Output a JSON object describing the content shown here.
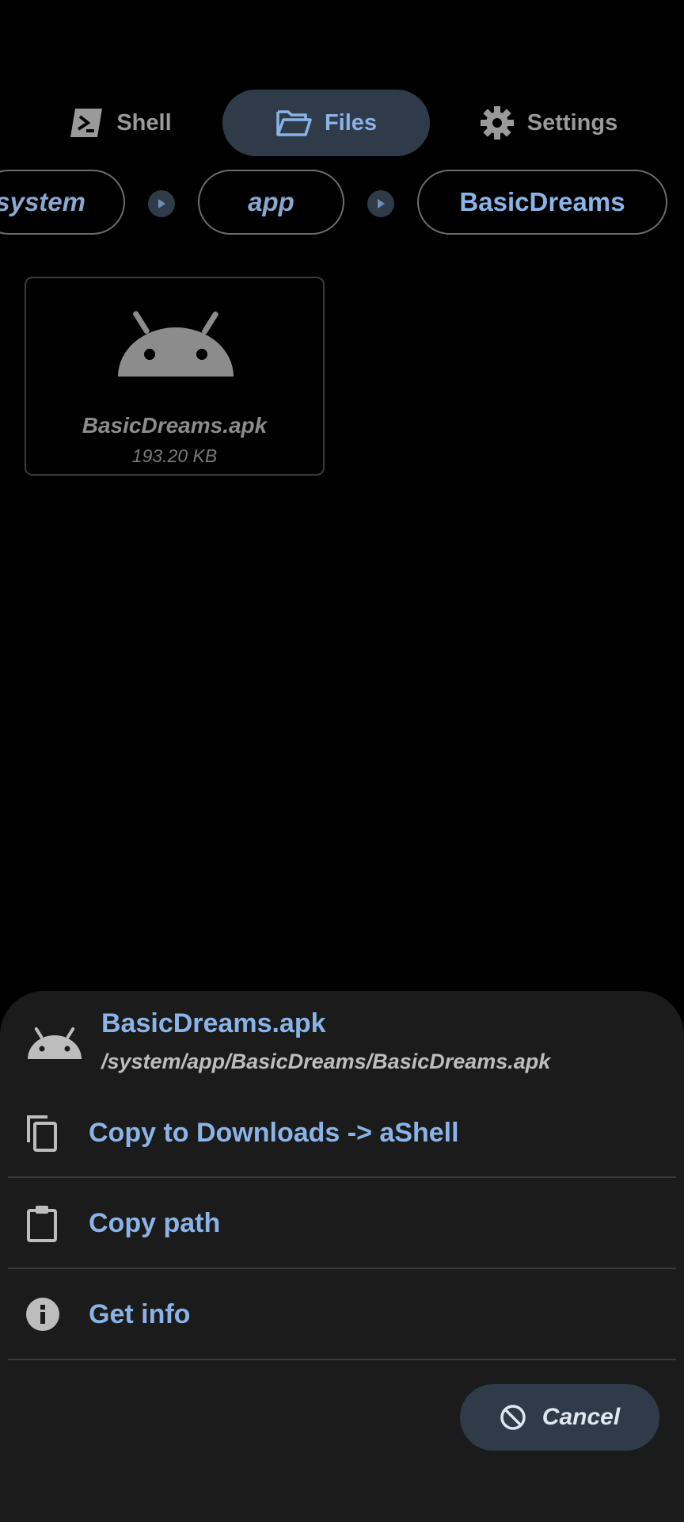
{
  "tabs": [
    {
      "label": "Shell",
      "icon": "terminal-icon",
      "active": false
    },
    {
      "label": "Files",
      "icon": "folder-open-icon",
      "active": true
    },
    {
      "label": "Settings",
      "icon": "gear-icon",
      "active": false
    }
  ],
  "breadcrumbs": [
    "system",
    "app",
    "BasicDreams"
  ],
  "file": {
    "name": "BasicDreams.apk",
    "size": "193.20 KB",
    "icon": "android-icon"
  },
  "sheet": {
    "title": "BasicDreams.apk",
    "path": "/system/app/BasicDreams/BasicDreams.apk",
    "actions": [
      {
        "label": "Copy to Downloads -> aShell",
        "icon": "copy-icon"
      },
      {
        "label": "Copy path",
        "icon": "clipboard-icon"
      },
      {
        "label": "Get info",
        "icon": "info-icon"
      }
    ],
    "cancel_label": "Cancel"
  },
  "colors": {
    "accent": "#8ab4e8",
    "background": "#000000",
    "sheet": "#1b1b1b",
    "pill": "#2f3b49"
  }
}
